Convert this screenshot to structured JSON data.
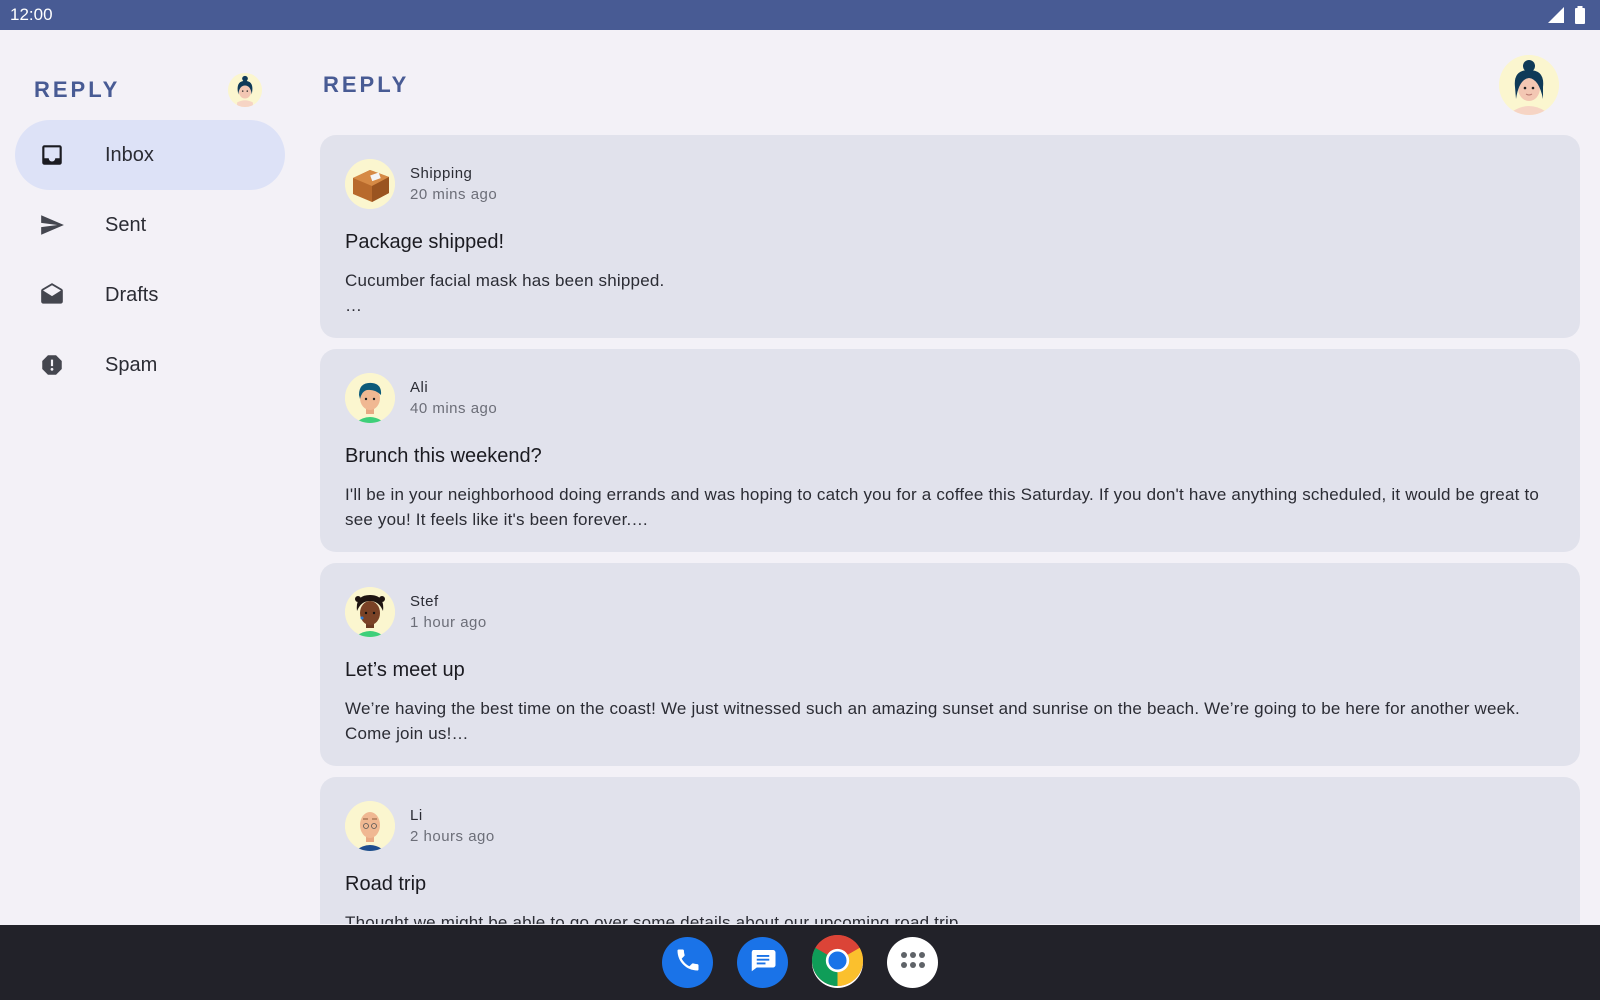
{
  "status_bar": {
    "time": "12:00",
    "icons": [
      "signal-icon",
      "battery-icon"
    ]
  },
  "sidebar": {
    "logo": "REPLY",
    "items": [
      {
        "label": "Inbox",
        "icon": "inbox-icon",
        "active": true
      },
      {
        "label": "Sent",
        "icon": "send-icon",
        "active": false
      },
      {
        "label": "Drafts",
        "icon": "drafts-icon",
        "active": false
      },
      {
        "label": "Spam",
        "icon": "report-icon",
        "active": false
      }
    ]
  },
  "main": {
    "logo": "REPLY",
    "emails": [
      {
        "sender": "Shipping",
        "time": "20 mins ago",
        "subject": "Package shipped!",
        "preview": "Cucumber facial mask has been shipped.\n…"
      },
      {
        "sender": "Ali",
        "time": "40 mins ago",
        "subject": "Brunch this weekend?",
        "preview": "I'll be in your neighborhood doing errands and was hoping to catch you for a coffee this Saturday. If you don't have anything scheduled, it would be great to see you! It feels like it's been forever.…"
      },
      {
        "sender": "Stef",
        "time": "1 hour ago",
        "subject": "Let’s meet up",
        "preview": "We’re having the best time on the coast! We just witnessed such an amazing sunset and sunrise on the beach. We’re going to be here for another week. Come join us!…"
      },
      {
        "sender": "Li",
        "time": "2 hours ago",
        "subject": "Road trip",
        "preview": "Thought we might be able to go over some details about our upcoming road trip."
      }
    ]
  },
  "taskbar": {
    "apps": [
      "phone-icon",
      "messages-icon",
      "chrome-icon",
      "app-drawer-icon"
    ]
  },
  "colors": {
    "status_bar": "#485b94",
    "background": "#f3f1f7",
    "nav_active": "#dde2f7",
    "card": "#e1e2ec",
    "taskbar": "#222229",
    "brand": "#485b94"
  }
}
